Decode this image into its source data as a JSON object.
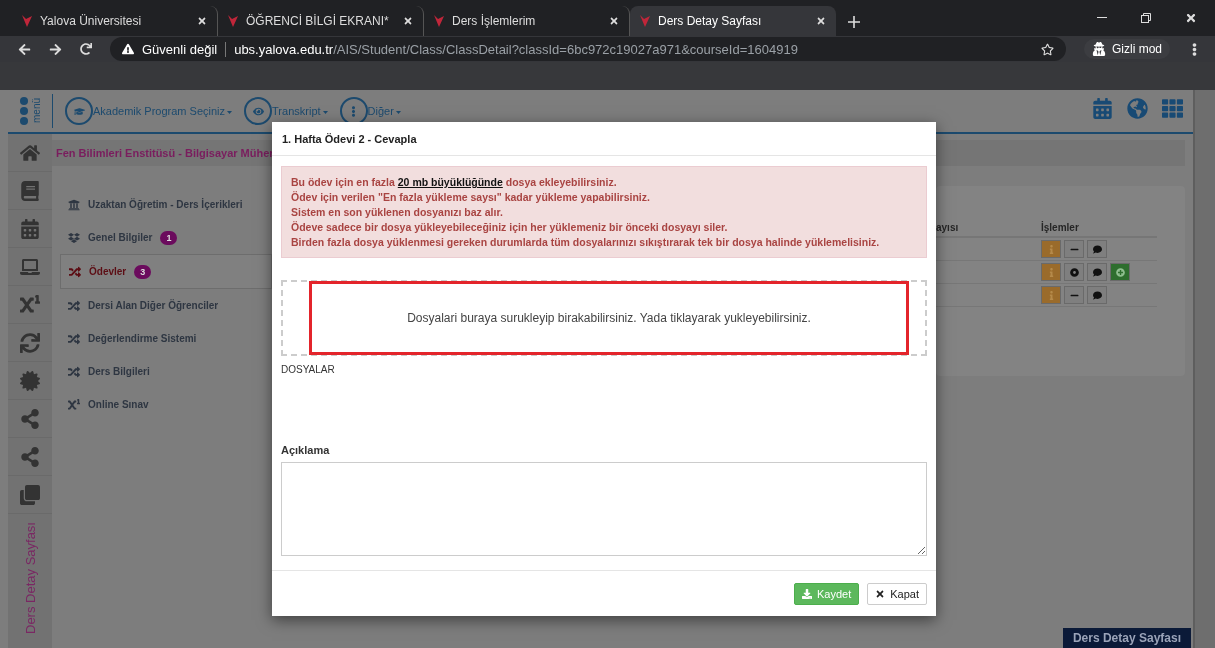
{
  "browser": {
    "tabs": [
      {
        "title": "Yalova Üniversitesi",
        "selected": false
      },
      {
        "title": "ÖĞRENCİ BİLGİ EKRANI*",
        "selected": false
      },
      {
        "title": "Ders İşlemlerim",
        "selected": false
      },
      {
        "title": "Ders Detay Sayfası",
        "selected": true
      }
    ],
    "address": {
      "security": "Güvenli değil",
      "domain": "ubs.yalova.edu.tr",
      "path": "/AIS/Student/Class/ClassDetail?classId=6bc972c19027a971&courseId=1604919"
    },
    "profile": "Gizli mod"
  },
  "page": {
    "menu_label": "menü",
    "topnav": [
      {
        "label": "Akademik Program Seçiniz",
        "kind": "cap"
      },
      {
        "label": "Transkript",
        "kind": "eye"
      },
      {
        "label": "Diğer",
        "kind": "dots"
      }
    ],
    "breadcrumb": "Fen Bilimleri Enstitüsü - Bilgisayar Müher",
    "side_title": "Ders Detay Sayfası",
    "menu": [
      {
        "label": "Uzaktan Öğretim - Ders İçerikleri",
        "kind": "university",
        "selected": false
      },
      {
        "label": "Genel Bilgiler",
        "kind": "dropbox",
        "badge": "1",
        "selected": false
      },
      {
        "label": "Ödevler",
        "kind": "shuffle",
        "badge": "3",
        "selected": true
      },
      {
        "label": "Dersi Alan Diğer Öğrenciler",
        "kind": "shuffle",
        "selected": false
      },
      {
        "label": "Değerlendirme Sistemi",
        "kind": "shuffle",
        "selected": false
      },
      {
        "label": "Ders Bilgileri",
        "kind": "shuffle",
        "selected": false
      },
      {
        "label": "Online Sınav",
        "kind": "superscript",
        "selected": false
      }
    ],
    "table": {
      "columns": [
        "ayısı",
        "İşlemler"
      ],
      "rows": [
        {
          "actions": [
            {
              "kind": "info"
            },
            {
              "kind": "minus"
            },
            {
              "kind": "comment"
            }
          ]
        },
        {
          "actions": [
            {
              "kind": "info"
            },
            {
              "kind": "target"
            },
            {
              "kind": "comment"
            },
            {
              "kind": "add"
            }
          ]
        },
        {
          "actions": [
            {
              "kind": "info"
            },
            {
              "kind": "minus"
            },
            {
              "kind": "comment"
            }
          ]
        }
      ]
    },
    "footer_tag": "Ders Detay Sayfası"
  },
  "modal": {
    "title": "1. Hafta Ödevi 2 - Cevapla",
    "notice": [
      "Bu ödev için en fazla **20 mb büyüklüğünde** dosya ekleyebilirsiniz.",
      "Ödev için verilen \"En fazla yükleme saysı\" kadar yükleme yapabilirsiniz.",
      "Sistem en son yüklenen dosyanızı baz alır.",
      "Ödeve sadece bir dosya yükleyebileceğiniz için her yüklemeniz bir önceki dosyayı siler.",
      "Birden fazla dosya yüklenmesi gereken durumlarda tüm dosyalarınızı sıkıştırarak tek bir dosya halinde yüklemelisiniz."
    ],
    "dropzone": "Dosyalari buraya surukleyip birakabilirsiniz. Yada tiklayarak yukleyebilirsiniz.",
    "files_label": "DOSYALAR",
    "description_label": "Açıklama",
    "buttons": [
      {
        "label": "Kaydet",
        "kind": "save"
      },
      {
        "label": "Kapat",
        "kind": "close"
      }
    ]
  }
}
